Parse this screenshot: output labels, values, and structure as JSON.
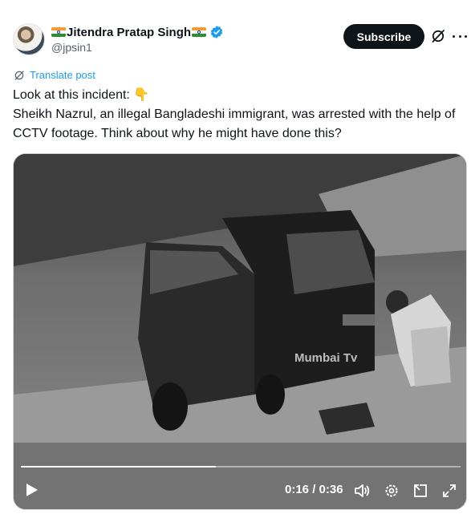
{
  "author": {
    "display_name": "Jitendra Pratap Singh",
    "handle": "@jpsin1",
    "avatar_icon": "profile-photo",
    "verified_icon": "verified-badge-icon",
    "verified_color": "#1d9bf0"
  },
  "header": {
    "subscribe_label": "Subscribe",
    "grok_icon": "grok-icon",
    "more_icon": "more-icon"
  },
  "post": {
    "translate_label": "Translate post",
    "line1": "Look at this incident: 👇",
    "line2": "Sheikh Nazrul, an illegal Bangladeshi immigrant, was arrested with the help of CCTV footage. Think about why he might have done this?"
  },
  "video": {
    "watermark": "Mumbai Tv",
    "current_time": "0:16",
    "duration": "0:36",
    "time_display": "0:16 / 0:36",
    "progress_fraction": 0.444,
    "controls": [
      "play-icon",
      "volume-icon",
      "settings-icon",
      "picture-in-picture-icon",
      "fullscreen-icon"
    ]
  },
  "colors": {
    "accent": "#1d9bf0",
    "text": "#0f1419",
    "secondary_text": "#536471",
    "button_bg": "#0f1419"
  }
}
